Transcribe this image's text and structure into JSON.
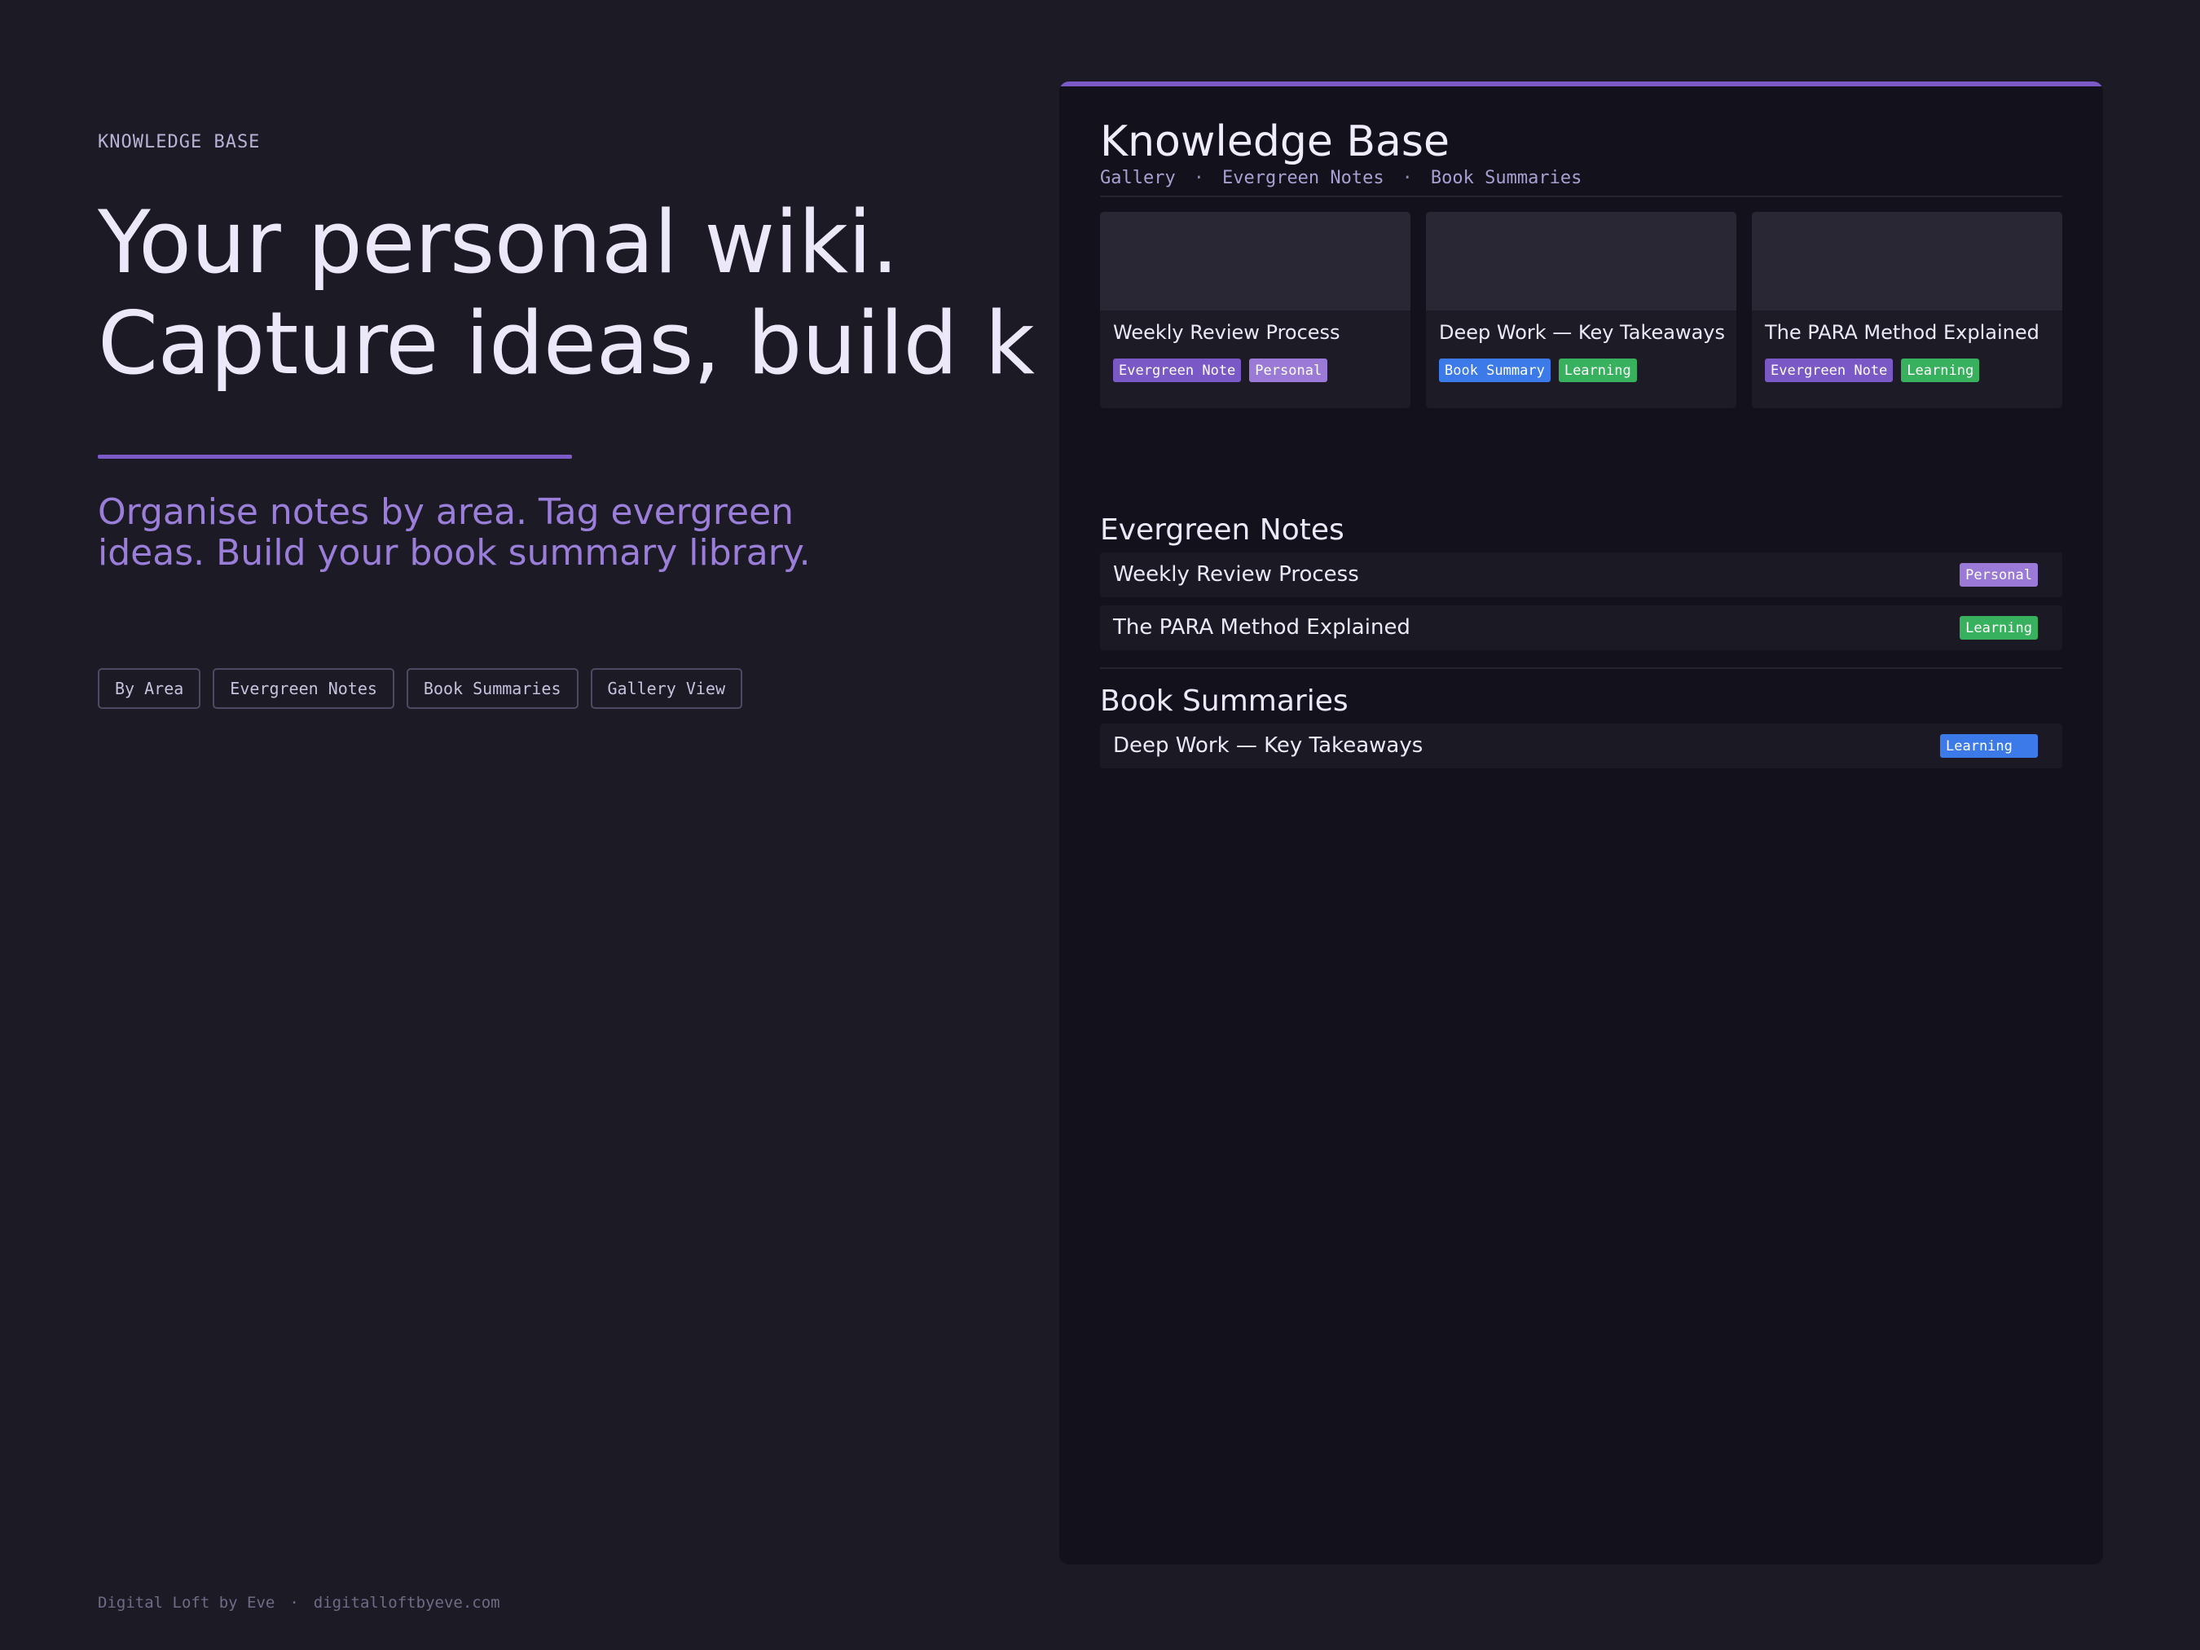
{
  "hero": {
    "eyebrow": "KNOWLEDGE BASE",
    "headline_line1": "Your personal wiki.",
    "headline_line2": "Capture ideas, build k",
    "subhead_line1": "Organise notes by area. Tag evergreen",
    "subhead_line2": "ideas. Build your book summary library.",
    "chips": [
      "By Area",
      "Evergreen Notes",
      "Book Summaries",
      "Gallery View"
    ]
  },
  "footer": {
    "brand": "Digital Loft by Eve",
    "separator": "·",
    "url": "digitalloftbyeve.com"
  },
  "panel": {
    "title": "Knowledge Base",
    "nav": [
      "Gallery",
      "Evergreen Notes",
      "Book Summaries"
    ],
    "nav_separator": "·",
    "gallery": [
      {
        "title": "Weekly Review Process",
        "tags": [
          "Evergreen Note",
          "Personal"
        ]
      },
      {
        "title": "Deep Work — Key Takeaways",
        "tags": [
          "Book Summary",
          "Learning"
        ]
      },
      {
        "title": "The PARA Method Explained",
        "tags": [
          "Evergreen Note",
          "Learning"
        ]
      }
    ],
    "evergreen": {
      "heading": "Evergreen Notes",
      "rows": [
        {
          "title": "Weekly Review Process",
          "tag": "Personal"
        },
        {
          "title": "The PARA Method Explained",
          "tag": "Learning"
        }
      ]
    },
    "books": {
      "heading": "Book Summaries",
      "rows": [
        {
          "title": "Deep Work — Key Takeaways",
          "tag": "Learning"
        }
      ]
    }
  },
  "colors": {
    "background": "#1c1b25",
    "panel": "#13121c",
    "accent": "#7c5bc9",
    "subhead": "#9b7ed9",
    "tag_evergreen": "#7a59c6",
    "tag_personal": "#9a7ad6",
    "tag_book_summary": "#3b7ae8",
    "tag_learning": "#37b15d"
  }
}
